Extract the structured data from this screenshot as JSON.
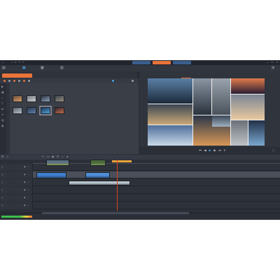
{
  "window": {
    "menu": [],
    "modes": []
  },
  "library": {
    "tab_label": "",
    "folder": "",
    "items": [
      {
        "caption": "",
        "c1": "#6b4b3a",
        "c2": "#d8a06a"
      },
      {
        "caption": "",
        "c1": "#7d7f85",
        "c2": "#c9ccd1"
      },
      {
        "caption": "",
        "c1": "#2c3440",
        "c2": "#8aa0b8"
      },
      {
        "caption": "",
        "c1": "#3d4550",
        "c2": "#9a8f80"
      },
      {
        "caption": "",
        "c1": "#5a6470",
        "c2": "#b8c0c8"
      },
      {
        "caption": "",
        "c1": "#2a3a55",
        "c2": "#5f7fa8"
      },
      {
        "caption": "",
        "c1": "#1f3a5a",
        "c2": "#4fa0d8"
      },
      {
        "caption": "",
        "c1": "#3a2a30",
        "c2": "#c06a4a"
      }
    ],
    "bottom_label": ""
  },
  "player": {
    "title": "",
    "tabs": [],
    "preview_tiles": [
      {
        "c1": "#5a7fa5",
        "c2": "#1d2a3a"
      },
      {
        "c1": "#8a95a3",
        "c2": "#2a323d"
      },
      {
        "c1": "#9aa3ad",
        "c2": "#4a525c"
      },
      {
        "c1": "#e07b4a",
        "c2": "#2a1d33"
      },
      {
        "c1": "#3b4652",
        "c2": "#c9a978"
      },
      {
        "c1": "#7a8594",
        "c2": "#e8c9a0"
      },
      {
        "c1": "#4f6f9a",
        "c2": "#c8d8e8"
      },
      {
        "c1": "#2a3648",
        "c2": "#d89858"
      },
      {
        "c1": "#6a7078",
        "c2": "#c0c4c8"
      },
      {
        "c1": "#223048",
        "c2": "#7aa8d0"
      },
      {
        "c1": "#3a4858",
        "c2": "#a0b0c0"
      }
    ],
    "left_label": "",
    "zoom_label": ""
  },
  "timeline": {
    "tracks": [
      {
        "name": ""
      },
      {
        "name": ""
      },
      {
        "name": ""
      },
      {
        "name": ""
      },
      {
        "name": ""
      },
      {
        "name": ""
      }
    ],
    "clips_track1": [
      {
        "c1": "#5a6f82",
        "c2": "#8aa04a"
      },
      {
        "c1": "#4a6a3a",
        "c2": "#7a9a5a"
      }
    ],
    "clips_track2": [
      {
        "c1": "#3f7fd0",
        "c2": "#2a4f80"
      },
      {
        "c1": "#4f8fd8",
        "c2": "#2a4f80"
      }
    ],
    "clips_track3": [
      {
        "c1": "#b8c4cc",
        "c2": "#5a6a74"
      }
    ]
  },
  "colors": {
    "accent": "#e8743a",
    "mode_tab": "#3a5f8e",
    "panel_bg": "#2b2f38",
    "playhead": "#d9431e"
  }
}
